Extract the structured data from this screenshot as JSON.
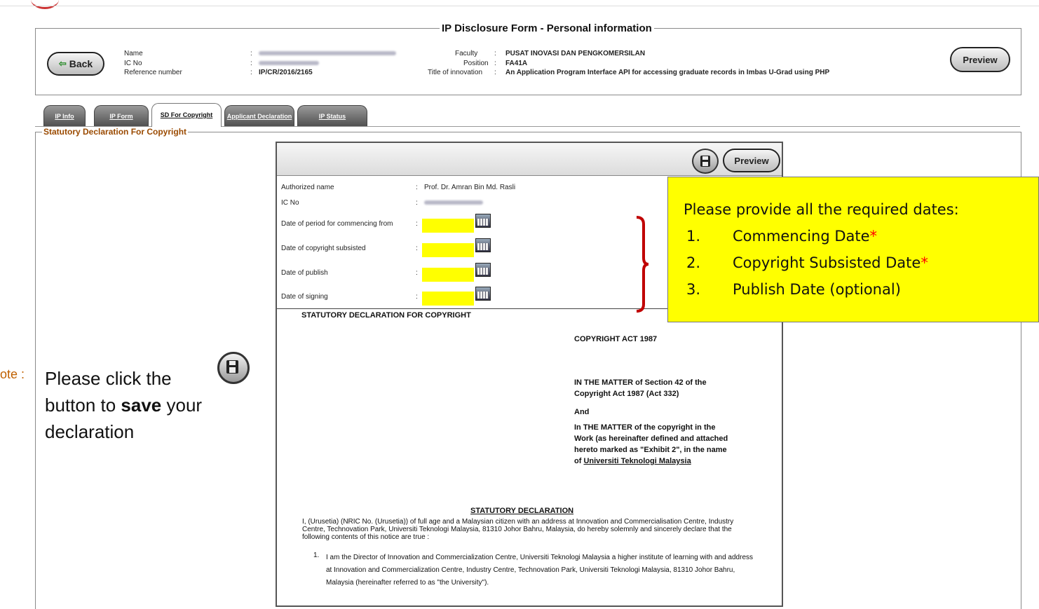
{
  "header": {
    "title": "IP Disclosure Form - Personal information",
    "back_label": "Back",
    "preview_label": "Preview",
    "fields": {
      "name_label": "Name",
      "ic_label": "IC No",
      "ref_label": "Reference number",
      "colon": ":",
      "ref_value": "IP/CR/2016/2165",
      "faculty_label": "Faculty",
      "faculty_value": "PUSAT INOVASI DAN PENGKOMERSILAN",
      "position_label": "Position",
      "position_value": "FA41A",
      "title_label": "Title of innovation",
      "title_value": "An Application Program Interface API for accessing graduate records in Imbas U-Grad using PHP"
    }
  },
  "tabs": [
    {
      "label": "IP Info"
    },
    {
      "label": "IP Form"
    },
    {
      "label": "SD For Copyright"
    },
    {
      "label": "Applicant Declaration"
    },
    {
      "label": "IP Status"
    }
  ],
  "section_title": "Statutory Declaration For Copyright",
  "panel": {
    "preview_label": "Preview",
    "authorized_label": "Authorized name",
    "authorized_value": "Prof. Dr. Amran Bin Md. Rasli",
    "ic_label": "IC No",
    "dates": [
      {
        "label": "Date of period for commencing from"
      },
      {
        "label": "Date of copyright subsisted"
      },
      {
        "label": "Date of publish"
      },
      {
        "label": "Date of signing"
      }
    ]
  },
  "document": {
    "heading": "STATUTORY DECLARATION FOR COPYRIGHT",
    "act": "COPYRIGHT ACT 1987",
    "matter1": "IN THE MATTER of Section 42 of the Copyright Act 1987 (Act 332)",
    "and": "And",
    "matter2_a": "In THE MATTER of the copyright in the Work (as hereinafter defined and attached hereto marked as \"Exhibit 2\", in the name of ",
    "matter2_b": "Universiti Teknologi Malaysia",
    "sd_heading": "STATUTORY DECLARATION",
    "para1": "I, (Urusetia) (NRIC No. (Urusetia)) of full age and a Malaysian citizen with an address at Innovation and Commercialisation Centre, Industry Centre, Technovation Park, Universiti Teknologi Malaysia, 81310 Johor Bahru, Malaysia, do hereby solemnly and sincerely declare that the following contents of this notice are true :",
    "item1_num": "1.",
    "item1": "I am the Director of Innovation and Commercialization Centre, Universiti Teknologi Malaysia a higher institute of learning with and address at Innovation and Commercialization Centre, Industry Centre, Technovation Park, Universiti Teknologi Malaysia, 81310 Johor Bahru, Malaysia (hereinafter referred to as \"the University\")."
  },
  "callout": {
    "title": "Please provide all the required dates:",
    "items": [
      {
        "num": "1.",
        "text": "Commencing Date",
        "star": "*"
      },
      {
        "num": "2.",
        "text": "Copyright Subsisted Date",
        "star": "*"
      },
      {
        "num": "3.",
        "text": "Publish Date (optional)",
        "star": ""
      }
    ]
  },
  "note": {
    "prefix": "ote :",
    "line1": "Please click the",
    "line2_a": "button to ",
    "line2_b": "save",
    "line2_c": " your",
    "line3": "declaration"
  },
  "colors": {
    "highlight": "#ffff00",
    "section_title": "#9a4a00",
    "bracket": "#c00000",
    "required_star": "#ff0000"
  }
}
